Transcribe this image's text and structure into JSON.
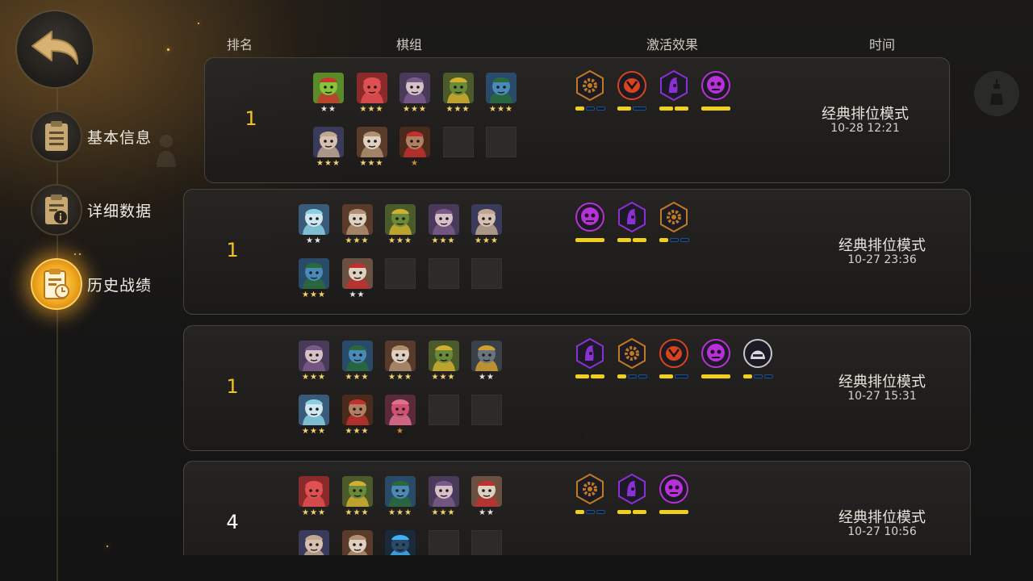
{
  "header": {
    "rank_label": "排名",
    "lineup_label": "棋组",
    "synergy_label": "激活效果",
    "time_label": "时间"
  },
  "nav": {
    "items": [
      {
        "label": "基本信息",
        "icon": "clipboard-icon",
        "active": false
      },
      {
        "label": "详细数据",
        "icon": "info-document-icon",
        "active": false
      },
      {
        "label": "历史战绩",
        "icon": "history-clock-icon",
        "active": true
      }
    ]
  },
  "matches": [
    {
      "rank": "1",
      "mode": "经典排位模式",
      "time": "10-28 12:21",
      "pieces": [
        {
          "name": "green-goblin-piece",
          "stars": "★★",
          "tier": "silver"
        },
        {
          "name": "red-ogre-piece",
          "stars": "★★★",
          "tier": "gold"
        },
        {
          "name": "hooded-mage-piece",
          "stars": "★★★",
          "tier": "gold"
        },
        {
          "name": "goblin-mech-piece",
          "stars": "★★★",
          "tier": "gold"
        },
        {
          "name": "goggle-tinker-piece",
          "stars": "★★★",
          "tier": "gold"
        },
        {
          "name": "horned-warrior-piece",
          "stars": "★★★",
          "tier": "gold"
        },
        {
          "name": "dragon-skull-piece",
          "stars": "★★★",
          "tier": "gold"
        },
        {
          "name": "bearded-pirate-piece",
          "stars": "★",
          "tier": "bronze"
        },
        {
          "name": "empty-slot",
          "stars": "",
          "tier": "none"
        },
        {
          "name": "empty-slot",
          "stars": "",
          "tier": "none"
        }
      ],
      "synergies": [
        {
          "name": "gear-hex-icon",
          "color": "#c07a22",
          "on": 1,
          "total": 3
        },
        {
          "name": "demon-face-icon",
          "color": "#d8441c",
          "on": 1,
          "total": 2
        },
        {
          "name": "hooded-assassin-icon",
          "color": "#8b2fd6",
          "on": 2,
          "total": 2
        },
        {
          "name": "skull-beast-icon",
          "color": "#b830d8",
          "on": 1,
          "total": 1
        }
      ]
    },
    {
      "rank": "1",
      "mode": "经典排位模式",
      "time": "10-27 23:36",
      "pieces": [
        {
          "name": "frost-beast-piece",
          "stars": "★★",
          "tier": "silver"
        },
        {
          "name": "dragon-skull-piece",
          "stars": "★★★",
          "tier": "gold"
        },
        {
          "name": "goblin-mech-piece",
          "stars": "★★★",
          "tier": "gold"
        },
        {
          "name": "hooded-mage-piece",
          "stars": "★★★",
          "tier": "gold"
        },
        {
          "name": "horned-warrior-piece",
          "stars": "★★★",
          "tier": "gold"
        },
        {
          "name": "goggle-tinker-piece",
          "stars": "★★★",
          "tier": "gold"
        },
        {
          "name": "masked-tribal-piece",
          "stars": "★★",
          "tier": "silver"
        },
        {
          "name": "empty-slot",
          "stars": "",
          "tier": "none"
        },
        {
          "name": "empty-slot",
          "stars": "",
          "tier": "none"
        },
        {
          "name": "empty-slot",
          "stars": "",
          "tier": "none"
        }
      ],
      "synergies": [
        {
          "name": "skull-beast-icon",
          "color": "#b830d8",
          "on": 1,
          "total": 1
        },
        {
          "name": "hooded-assassin-icon",
          "color": "#8b2fd6",
          "on": 2,
          "total": 2
        },
        {
          "name": "gear-hex-icon",
          "color": "#c07a22",
          "on": 1,
          "total": 3
        }
      ]
    },
    {
      "rank": "1",
      "mode": "经典排位模式",
      "time": "10-27 15:31",
      "pieces": [
        {
          "name": "hooded-mage-piece",
          "stars": "★★★",
          "tier": "gold"
        },
        {
          "name": "goggle-tinker-piece",
          "stars": "★★★",
          "tier": "gold"
        },
        {
          "name": "dragon-skull-piece",
          "stars": "★★★",
          "tier": "gold"
        },
        {
          "name": "goblin-mech-piece",
          "stars": "★★★",
          "tier": "gold"
        },
        {
          "name": "stone-golem-piece",
          "stars": "★★",
          "tier": "silver"
        },
        {
          "name": "frost-beast-piece",
          "stars": "★★★",
          "tier": "gold"
        },
        {
          "name": "bearded-pirate-piece",
          "stars": "★★★",
          "tier": "gold"
        },
        {
          "name": "pink-blob-piece",
          "stars": "★",
          "tier": "bronze"
        },
        {
          "name": "empty-slot",
          "stars": "",
          "tier": "none"
        },
        {
          "name": "empty-slot",
          "stars": "",
          "tier": "none"
        }
      ],
      "synergies": [
        {
          "name": "hooded-assassin-icon",
          "color": "#8b2fd6",
          "on": 2,
          "total": 2
        },
        {
          "name": "gear-hex-icon",
          "color": "#c07a22",
          "on": 1,
          "total": 3
        },
        {
          "name": "demon-face-icon",
          "color": "#d8441c",
          "on": 1,
          "total": 2
        },
        {
          "name": "skull-beast-icon",
          "color": "#b830d8",
          "on": 1,
          "total": 1
        },
        {
          "name": "helmet-knight-icon",
          "color": "#8e8e94",
          "on": 1,
          "total": 3
        }
      ]
    },
    {
      "rank": "4",
      "mode": "经典排位模式",
      "time": "10-27 10:56",
      "pieces": [
        {
          "name": "red-ogre-piece",
          "stars": "★★★",
          "tier": "gold"
        },
        {
          "name": "goblin-mech-piece",
          "stars": "★★★",
          "tier": "gold"
        },
        {
          "name": "goggle-tinker-piece",
          "stars": "★★★",
          "tier": "gold"
        },
        {
          "name": "hooded-mage-piece",
          "stars": "★★★",
          "tier": "gold"
        },
        {
          "name": "masked-tribal-piece",
          "stars": "★★",
          "tier": "silver"
        },
        {
          "name": "horned-warrior-piece",
          "stars": "",
          "tier": "gold"
        },
        {
          "name": "dragon-skull-piece",
          "stars": "",
          "tier": "gold"
        },
        {
          "name": "blue-crystal-piece",
          "stars": "",
          "tier": "gold"
        },
        {
          "name": "empty-slot",
          "stars": "",
          "tier": "none"
        },
        {
          "name": "empty-slot",
          "stars": "",
          "tier": "none"
        }
      ],
      "synergies": [
        {
          "name": "gear-hex-icon",
          "color": "#c07a22",
          "on": 1,
          "total": 3
        },
        {
          "name": "hooded-assassin-icon",
          "color": "#8b2fd6",
          "on": 2,
          "total": 2
        },
        {
          "name": "skull-beast-icon",
          "color": "#b830d8",
          "on": 1,
          "total": 1
        }
      ]
    }
  ],
  "colors": {
    "rank_first": "#f3c21b",
    "rank_other": "#ffffff",
    "accent_gold": "#f0cf1e"
  }
}
